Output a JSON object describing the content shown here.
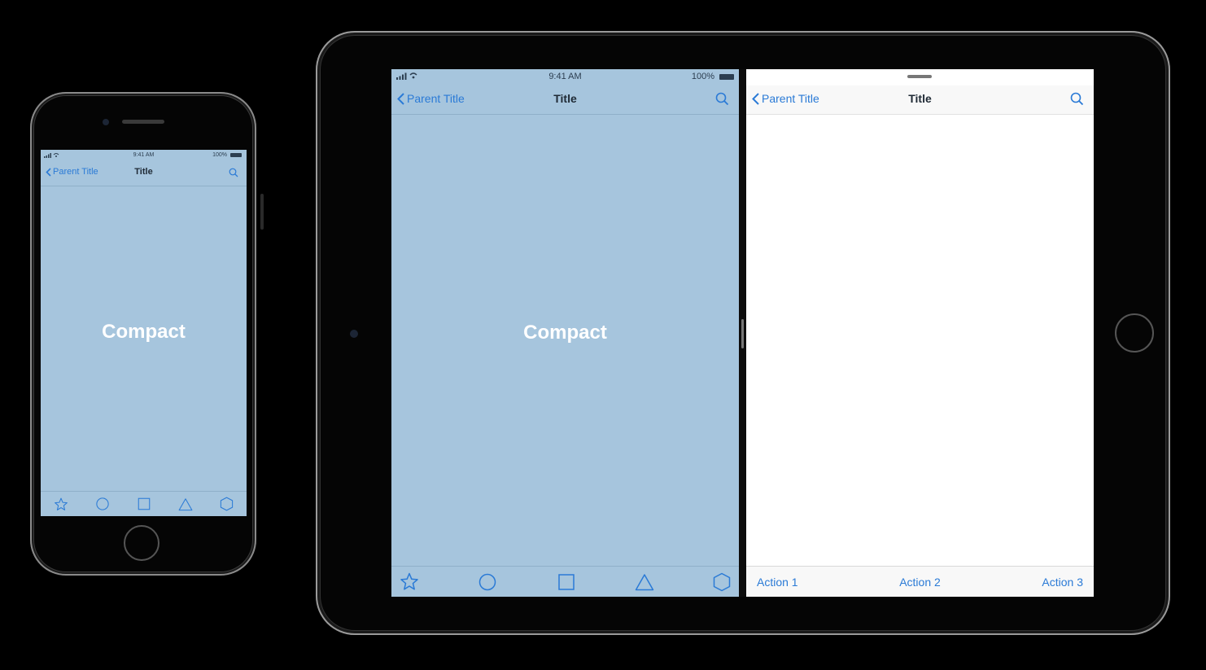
{
  "colors": {
    "compact_bg": "#a6c5dd",
    "tint": "#2a7ad6",
    "title_text": "#1f2a35",
    "label_text": "#ffffff"
  },
  "iphone": {
    "status": {
      "time": "9:41 AM",
      "battery": "100%"
    },
    "nav": {
      "back_label": "Parent Title",
      "title": "Title"
    },
    "content_label": "Compact",
    "tabs": [
      "star-icon",
      "circle-icon",
      "square-icon",
      "triangle-icon",
      "hexagon-icon"
    ]
  },
  "ipad_left": {
    "status": {
      "time": "9:41 AM",
      "battery": "100%"
    },
    "nav": {
      "back_label": "Parent Title",
      "title": "Title"
    },
    "content_label": "Compact",
    "tabs": [
      "star-icon",
      "circle-icon",
      "square-icon",
      "triangle-icon",
      "hexagon-icon"
    ]
  },
  "ipad_right": {
    "nav": {
      "back_label": "Parent Title",
      "title": "Title"
    },
    "actions": [
      "Action 1",
      "Action 2",
      "Action 3"
    ]
  }
}
